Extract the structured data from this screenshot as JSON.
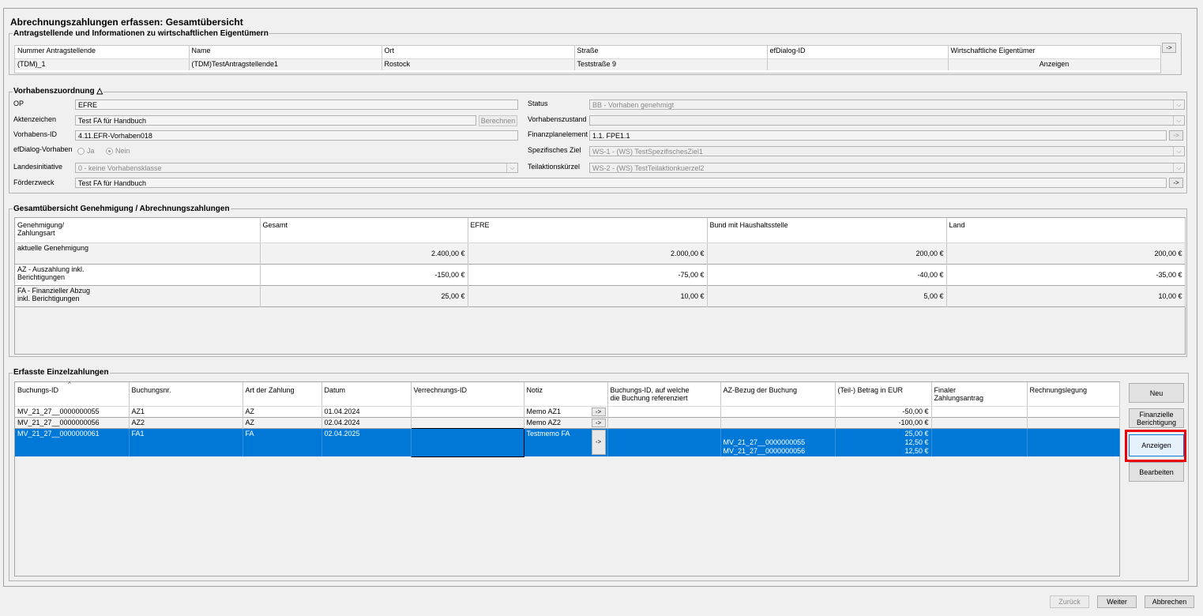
{
  "window": {
    "title": "Abrechnungszahlungen erfassen: Gesamtübersicht"
  },
  "applicant": {
    "title": "Antragstellende und Informationen zu wirtschaftlichen Eigentümern",
    "columns": [
      "Nummer Antragstellende",
      "Name",
      "Ort",
      "Straße",
      "efDialog-ID",
      "Wirtschaftliche Eigentümer"
    ],
    "row": {
      "nummer": "(TDM)_1",
      "name": "(TDM)TestAntragstellende1",
      "ort": "Rostock",
      "strasse": "Teststraße 9",
      "efdialog_id": "",
      "owners_button": "Anzeigen"
    },
    "nav_button": "->"
  },
  "project": {
    "title": "Vorhabenszuordnung",
    "title_icon": "triangle-up-icon",
    "op_label": "OP",
    "op_value": "EFRE",
    "aktenzeichen_label": "Aktenzeichen",
    "aktenzeichen_value": "Test FA für Handbuch",
    "berechnen_button": "Berechnen",
    "vorhabens_id_label": "Vorhabens-ID",
    "vorhabens_id_value": "4.11.EFR-Vorhaben018",
    "efdialog_label": "efDialog-Vorhaben",
    "radio_ja": "Ja",
    "radio_nein": "Nein",
    "radio_selected": "Nein",
    "landesinitiative_label": "Landesinitiative",
    "landesinitiative_value": "0 - keine Vorhabensklasse",
    "foerderzweck_label": "Förderzweck",
    "foerderzweck_value": "Test FA für Handbuch",
    "status_label": "Status",
    "status_value": "BB - Vorhaben genehmigt",
    "zustand_label": "Vorhabenszustand",
    "zustand_value": "",
    "finanzplan_label": "Finanzplanelement",
    "finanzplan_value": "1.1. FPE1.1",
    "ziel_label": "Spezifisches Ziel",
    "ziel_value": "WS-1 - (WS) TestSpezifischesZiel1",
    "teilaktion_label": "Teilaktionskürzel",
    "teilaktion_value": "WS-2 - (WS) TestTeilaktionkuerzel2",
    "nav_button": "->"
  },
  "overview": {
    "title": "Gesamtübersicht Genehmigung / Abrechnungszahlungen",
    "columns": [
      "Genehmigung/\nZahlungsart",
      "Gesamt",
      "EFRE",
      "Bund mit Haushaltsstelle",
      "Land"
    ],
    "rows": [
      {
        "label": "aktuelle Genehmigung",
        "gesamt": "2.400,00 €",
        "efre": "2.000,00 €",
        "bund": "200,00 €",
        "land": "200,00 €"
      },
      {
        "label": "AZ - Auszahlung inkl.\nBerichtigungen",
        "gesamt": "-150,00 €",
        "efre": "-75,00 €",
        "bund": "-40,00 €",
        "land": "-35,00 €"
      },
      {
        "label": "FA - Finanzieller Abzug\ninkl. Berichtigungen",
        "gesamt": "25,00 €",
        "efre": "10,00 €",
        "bund": "5,00 €",
        "land": "10,00 €"
      }
    ]
  },
  "payments": {
    "title": "Erfasste Einzelzahlungen",
    "sort_icon": "sort-ascending-icon",
    "columns": [
      "Buchungs-ID",
      "Buchungsnr.",
      "Art der Zahlung",
      "Datum",
      "Verrechnungs-ID",
      "Notiz",
      "Buchungs-ID, auf welche\ndie Buchung referenziert",
      "AZ-Bezug der Buchung",
      "(Teil-) Betrag in EUR",
      "Finaler\nZahlungsantrag",
      "Rechnungslegung"
    ],
    "rows": [
      {
        "buchungs_id": "MV_21_27__0000000055",
        "buchungsnr": "AZ1",
        "art": "AZ",
        "datum": "01.04.2024",
        "verrechnungs_id": "",
        "notiz": "Memo AZ1",
        "ref": "",
        "az_bezug": "",
        "betrag": "-50,00 €",
        "final": "",
        "rechnung": ""
      },
      {
        "buchungs_id": "MV_21_27__0000000056",
        "buchungsnr": "AZ2",
        "art": "AZ",
        "datum": "02.04.2024",
        "verrechnungs_id": "",
        "notiz": "Memo AZ2",
        "ref": "",
        "az_bezug": "",
        "betrag": "-100,00 €",
        "final": "",
        "rechnung": ""
      },
      {
        "buchungs_id": "MV_21_27__0000000061",
        "buchungsnr": "FA1",
        "art": "FA",
        "datum": "02.04.2025",
        "verrechnungs_id": "",
        "notiz": "Testmemo FA",
        "ref": "",
        "az_bezug_1": "MV_21_27__0000000055",
        "az_bezug_2": "MV_21_27__0000000056",
        "betrag_1": "25,00 €",
        "betrag_2": "12,50 €",
        "betrag_3": "12,50 €",
        "final": "",
        "rechnung": ""
      }
    ],
    "notiz_button": "->",
    "side_buttons": {
      "neu": "Neu",
      "berichtigung": "Finanzielle\nBerichtigung",
      "anzeigen": "Anzeigen",
      "bearbeiten": "Bearbeiten"
    },
    "highlight_color": "#e8000b",
    "selection_color": "#0078d7"
  },
  "footer": {
    "back": "Zurück",
    "next": "Weiter",
    "cancel": "Abbrechen"
  }
}
